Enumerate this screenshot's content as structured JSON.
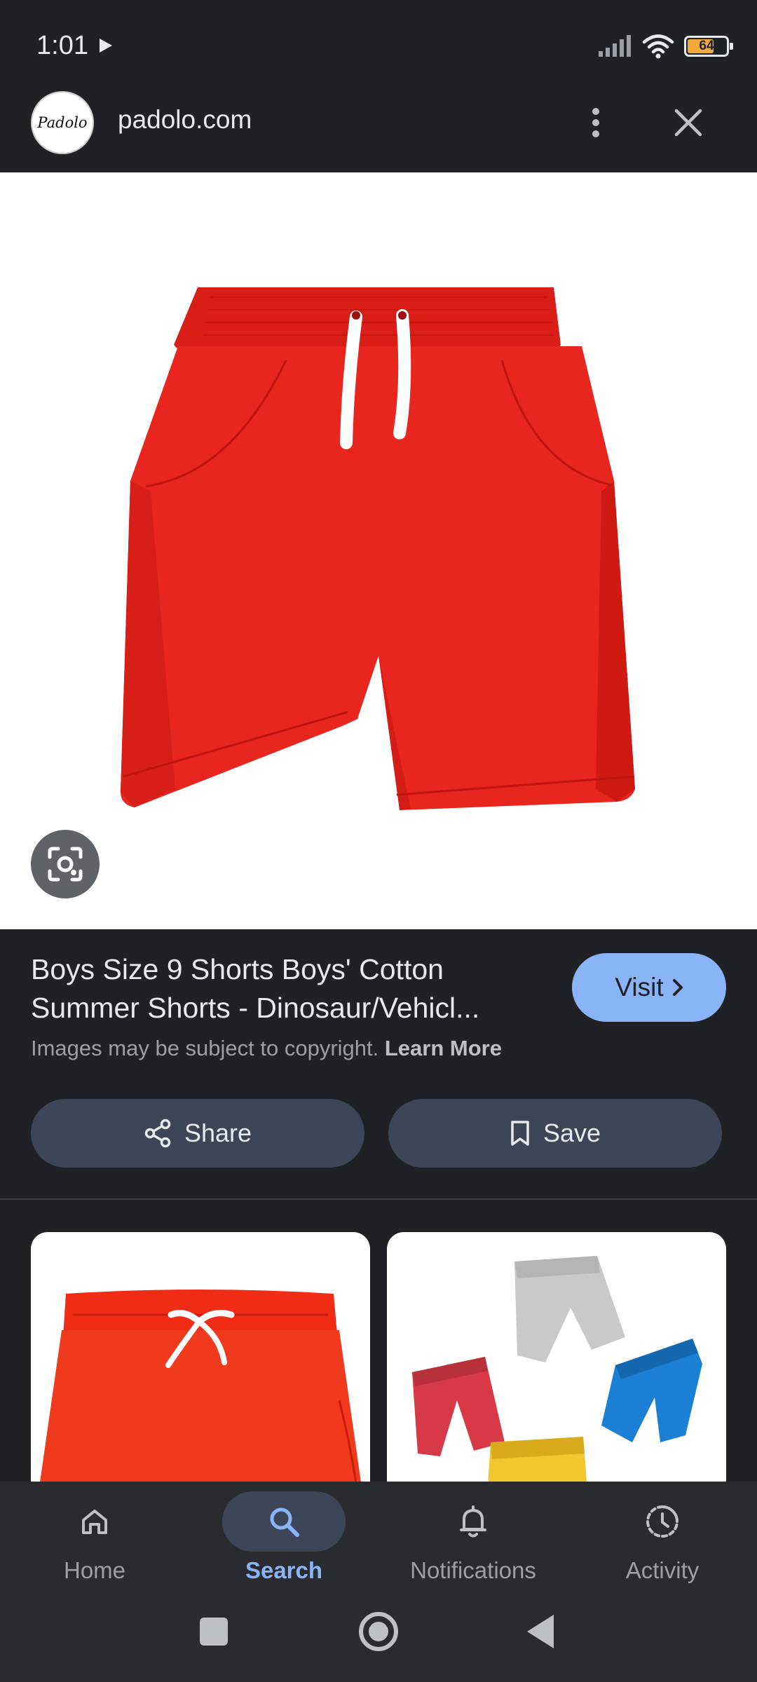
{
  "status_bar": {
    "time": "1:01",
    "battery_level": "64"
  },
  "header": {
    "site_name": "padolo.com",
    "logo_text": "Padolo"
  },
  "main_image": {
    "subject": "red shorts with white drawstring"
  },
  "product": {
    "title_line1": "Boys Size 9 Shorts Boys' Cotton",
    "title_line2": "Summer Shorts - Dinosaur/Vehicl...",
    "visit_label": "Visit",
    "copyright_text": "Images may be subject to copyright.",
    "learn_more": "Learn More",
    "share_label": "Share",
    "save_label": "Save"
  },
  "bottom_nav": {
    "items": [
      {
        "label": "Home",
        "icon": "home-icon"
      },
      {
        "label": "Search",
        "icon": "search-icon",
        "active": true
      },
      {
        "label": "Notifications",
        "icon": "bell-icon"
      },
      {
        "label": "Activity",
        "icon": "activity-icon"
      }
    ]
  },
  "colors": {
    "background": "#202124",
    "accent": "#8ab4f8",
    "button": "#3c4658",
    "product_red": "#e8261f"
  }
}
